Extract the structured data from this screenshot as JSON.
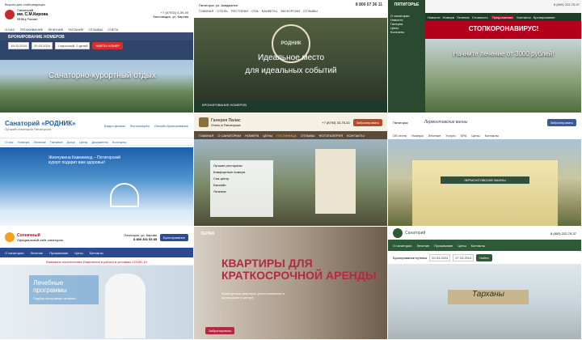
{
  "t1": {
    "access": "Версия для слабовидящих",
    "logo_line1": "Санаторий",
    "logo_line2": "им. С.М.Кирова",
    "logo_sub": "ФНКЦ России",
    "phone": "+7 (87933) 5-39-39",
    "address": "Кисловодск, ул. Кирова",
    "nav": [
      "О НАС",
      "ПРОЖИВАНИЕ",
      "ЛЕЧЕНИЕ",
      "ПИТАНИЕ",
      "ОТЗЫВЫ",
      "СЧЕТА"
    ],
    "booking_title": "БРОНИРОВАНИЕ НОМЕРОВ",
    "date_in": "19.03.2024",
    "date_out": "20.03.2024",
    "guests": "1 взрослый, 0 детей",
    "search_button": "НАЙТИ НОМЕР",
    "hero_text": "Санаторно-курортный отдых"
  },
  "t2": {
    "city": "Пятигорск, ул. Акаджанян",
    "nav": [
      "ГЛАВНАЯ",
      "ОТЕЛЬ",
      "РЕСТОРАН",
      "СПА",
      "БАНКЕТЫ",
      "ЭКСКУРСИИ",
      "ОТЗЫВЫ"
    ],
    "phone": "8 800 07 36 11",
    "logo_text": "РОДНИК",
    "hero_line1": "Идеальное место",
    "hero_line2": "для идеальных событий",
    "booking": "БРОНИРОВАНИЕ НОМЕРОВ"
  },
  "t3": {
    "brand": "ПЯТИГОРЬЕ",
    "menu": [
      "О санатории",
      "Новости",
      "Галерея",
      "Цены",
      "Контакты"
    ],
    "tabs": [
      "Новости",
      "Номера",
      "Лечение",
      "Стоимость",
      "Предложения",
      "Контакты",
      "Бронирование"
    ],
    "phones": "8 (800) 222-75-37",
    "alert": "СТОПКОРОНАВИРУС!",
    "promo": "Начните лечение от 3000 рублей!"
  },
  "t4": {
    "title": "Санаторий «РОДНИК»",
    "subtitle": "Лучший санаторий Пятигорска",
    "email": "info@rodnik.ru",
    "phone": "8 800 000 00 00",
    "video": "Видео-фильм",
    "photos": "Фотогалерея",
    "online": "Онлайн-бронирование",
    "nav": [
      "О нас",
      "Номера",
      "Лечение",
      "Питание",
      "Досуг",
      "Цены",
      "Документы",
      "Контакты"
    ],
    "hero_text": "Жемчужина Кавминвод – Пятигорский курорт подарит вам здоровье!"
  },
  "t5": {
    "title": "Галерея Палас",
    "subtitle": "Отель в Пятигорске",
    "phones": "+7 (8793) 33-75-33",
    "book": "Забронировать",
    "nav": [
      "ГЛАВНАЯ",
      "О САНАТОРИИ",
      "НОМЕРА",
      "ЦЕНЫ",
      "ГОСТИНИЦА",
      "ОТЗЫВЫ",
      "ФОТОГАЛЕРЕЯ",
      "КОНТАКТЫ"
    ],
    "features": [
      "Лучшие рестораны",
      "Комфортные номера",
      "Спа-центр",
      "Бассейн",
      "Лечение"
    ]
  },
  "t6": {
    "brand": "Лермонтовские ванны",
    "city": "Пятигорск",
    "cta": "Забронировать",
    "nav": [
      "Об отеле",
      "Номера",
      "Лечение",
      "Услуги",
      "SPA",
      "Цены",
      "Контакты"
    ],
    "building_sign": "ЛЕРМОНТОВСКИЕ ВАННЫ"
  },
  "t7": {
    "brand": "Солнечный",
    "desc": "Официальный сайт санатория",
    "address": "Пятигорск, ул. Кирова",
    "phones": "8 800 301 53 85",
    "book": "Бронирование",
    "nav": [
      "О санатории",
      "Лечение",
      "Проживание",
      "Цены",
      "Контакты"
    ],
    "warning": "Внимание посетителям! Изменения в работе в условиях COVID-19",
    "hero_title": "Лечебные программы",
    "hero_sub": "Подбор программы лечения"
  },
  "t8": {
    "logo": "ТЕРМА",
    "hero_line1": "КВАРТИРЫ ДЛЯ",
    "hero_line2": "КРАТКОСРОЧНОЙ АРЕНДЫ",
    "desc": "Комфортные квартиры, расположенные в одном доме в центре",
    "button": "Забронировать"
  },
  "t9": {
    "brand": "Санаторий",
    "phone": "8 (800) 222-75-37",
    "nav": [
      "О санатории",
      "Лечение",
      "Проживание",
      "Цены",
      "Контакты"
    ],
    "booking": "Бронирование путевок",
    "date_in": "20.03.2024",
    "date_out": "27.03.2024",
    "find": "Найти",
    "sign": "Тарханы"
  },
  "colors": {
    "brand_blue": "#23375f",
    "forest_green": "#2a4a30",
    "alert_red": "#b5001d",
    "palace_brown": "#5a4a3a",
    "solar_blue": "#2b4a8f"
  }
}
